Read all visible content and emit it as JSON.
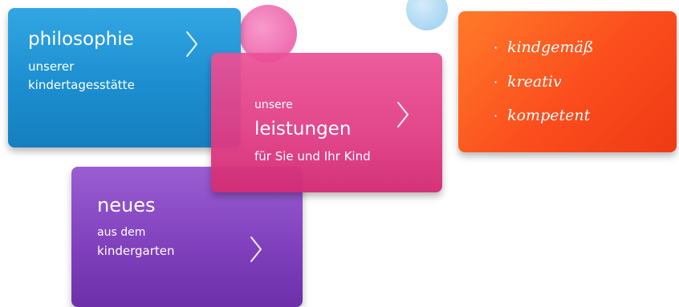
{
  "tiles": {
    "philosophie": {
      "title": "philosophie",
      "line1": "unserer",
      "line2": "kindertagesstätte",
      "color": "#1c8ed0"
    },
    "leistungen": {
      "line1": "unsere",
      "title": "leistungen",
      "line2": "für Sie und Ihr Kind",
      "color": "#e03c84"
    },
    "neues": {
      "title": "neues",
      "line1": "aus dem",
      "line2": "kindergarten",
      "color": "#7f3fbc"
    },
    "keywords": {
      "items": [
        {
          "bullet": "·",
          "text": "kindgemäß"
        },
        {
          "bullet": "·",
          "text": "kreativ"
        },
        {
          "bullet": "·",
          "text": "kompetent"
        }
      ],
      "color": "#fb4d1d"
    }
  },
  "icons": {
    "next": "chevron-right-icon"
  }
}
